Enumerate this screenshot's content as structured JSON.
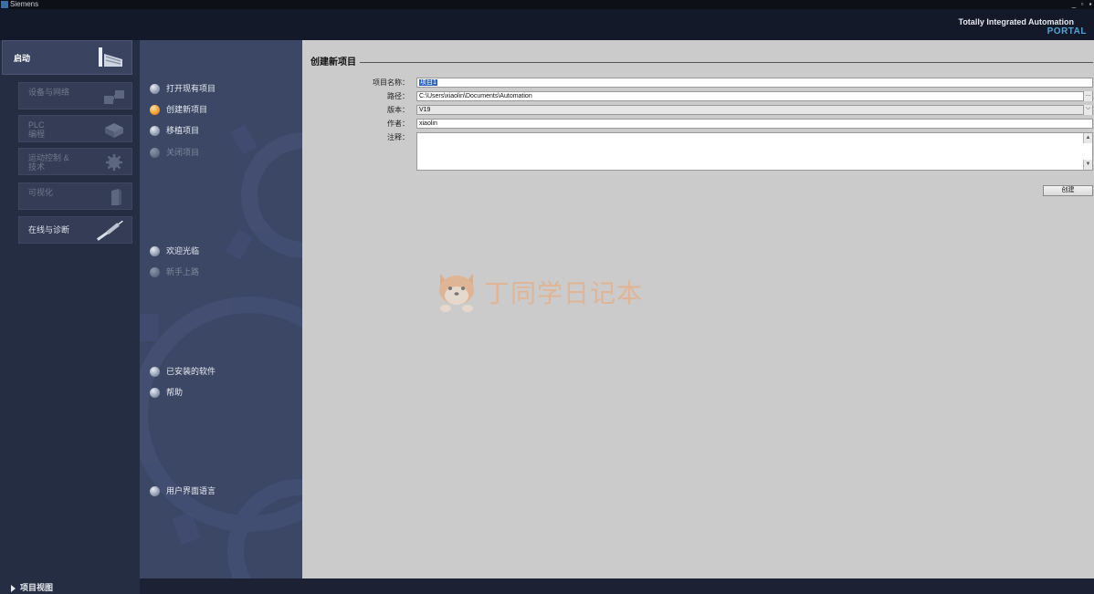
{
  "window": {
    "title": "Siemens",
    "minimize_glyph": "_",
    "maximize_glyph": "▫",
    "close_glyph": "▪"
  },
  "header": {
    "brand_line1": "Totally Integrated Automation",
    "brand_line2": "PORTAL"
  },
  "sidebar": {
    "items": [
      {
        "label": "启动",
        "icon": "start-icon",
        "state": "active"
      },
      {
        "label": "设备与网络",
        "icon": "devices-network-icon",
        "state": "disabled"
      },
      {
        "label": "PLC\n编程",
        "icon": "plc-programming-icon",
        "state": "disabled"
      },
      {
        "label": "运动控制 &\n技术",
        "icon": "gear-icon",
        "state": "disabled"
      },
      {
        "label": "可视化",
        "icon": "visualization-icon",
        "state": "disabled"
      },
      {
        "label": "在线与诊断",
        "icon": "diagnostics-probe-icon",
        "state": "enabled"
      }
    ],
    "project_view_label": "项目视图"
  },
  "middle": {
    "items": [
      {
        "label": "打开现有项目",
        "state": "normal"
      },
      {
        "label": "创建新项目",
        "state": "active"
      },
      {
        "label": "移植项目",
        "state": "normal"
      },
      {
        "label": "关闭项目",
        "state": "disabled"
      },
      {
        "label": "欢迎光临",
        "state": "normal"
      },
      {
        "label": "新手上路",
        "state": "disabled"
      },
      {
        "label": "已安装的软件",
        "state": "normal"
      },
      {
        "label": "帮助",
        "state": "normal"
      },
      {
        "label": "用户界面语言",
        "state": "normal"
      }
    ]
  },
  "form": {
    "title": "创建新项目",
    "project_name_label": "项目名称：",
    "project_name_value": "项目1",
    "path_label": "路径：",
    "path_value": "C:\\Users\\xiaolin\\Documents\\Automation",
    "path_browse": "...",
    "version_label": "版本：",
    "version_value": "V19",
    "author_label": "作者：",
    "author_value": "xiaolin",
    "comment_label": "注释：",
    "comment_value": "",
    "create_button": "创建"
  },
  "watermark": {
    "text": "丁同学日记本"
  },
  "colors": {
    "accent_orange": "#f5a233",
    "brand_blue": "#4fa3d6",
    "content_bg": "#cbcbcb"
  }
}
